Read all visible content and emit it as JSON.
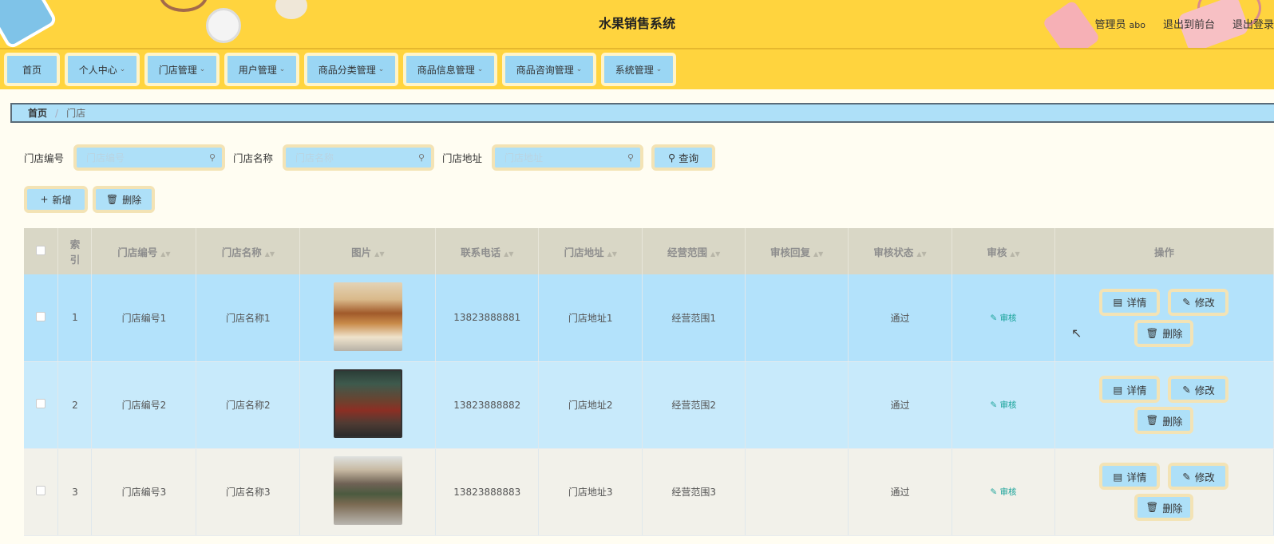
{
  "header": {
    "title": "水果销售系统",
    "role_label": "管理员",
    "user_name": "abo",
    "to_front": "退出到前台",
    "logout": "退出登录"
  },
  "nav": {
    "items": [
      {
        "label": "首页",
        "dropdown": false
      },
      {
        "label": "个人中心",
        "dropdown": true
      },
      {
        "label": "门店管理",
        "dropdown": true
      },
      {
        "label": "用户管理",
        "dropdown": true
      },
      {
        "label": "商品分类管理",
        "dropdown": true
      },
      {
        "label": "商品信息管理",
        "dropdown": true
      },
      {
        "label": "商品咨询管理",
        "dropdown": true
      },
      {
        "label": "系统管理",
        "dropdown": true
      }
    ]
  },
  "breadcrumb": {
    "home": "首页",
    "separator": "/",
    "current": "门店"
  },
  "search": {
    "store_no_label": "门店编号",
    "store_no_placeholder": "门店编号",
    "store_name_label": "门店名称",
    "store_name_placeholder": "门店名称",
    "store_addr_label": "门店地址",
    "store_addr_placeholder": "门店地址",
    "query_label": "查询"
  },
  "actions": {
    "add_label": "新增",
    "delete_label": "删除"
  },
  "table": {
    "columns": [
      "索引",
      "门店编号",
      "门店名称",
      "图片",
      "联系电话",
      "门店地址",
      "经营范围",
      "审核回复",
      "审核状态",
      "审核",
      "操作"
    ],
    "index_col_line1": "索",
    "index_col_line2": "引",
    "rows": [
      {
        "index": "1",
        "store_no": "门店编号1",
        "store_name": "门店名称1",
        "phone": "13823888881",
        "address": "门店地址1",
        "scope": "经营范围1",
        "reply": "",
        "status": "通过",
        "audit": "审核"
      },
      {
        "index": "2",
        "store_no": "门店编号2",
        "store_name": "门店名称2",
        "phone": "13823888882",
        "address": "门店地址2",
        "scope": "经营范围2",
        "reply": "",
        "status": "通过",
        "audit": "审核"
      },
      {
        "index": "3",
        "store_no": "门店编号3",
        "store_name": "门店名称3",
        "phone": "13823888883",
        "address": "门店地址3",
        "scope": "经营范围3",
        "reply": "",
        "status": "通过",
        "audit": "审核"
      }
    ],
    "op_detail": "详情",
    "op_edit": "修改",
    "op_delete": "删除"
  },
  "colors": {
    "header_bg": "#ffd43e",
    "button_bg": "#aee0f8",
    "row_selected": "#b3e2fb",
    "link": "#1aa39a"
  }
}
